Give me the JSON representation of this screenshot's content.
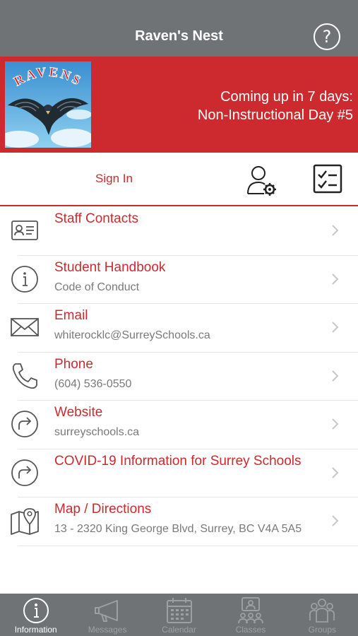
{
  "header": {
    "title": "Raven's Nest",
    "help_symbol": "?"
  },
  "banner": {
    "logo_text": "RAVENS",
    "line1": "Coming up in 7 days:",
    "line2": "Non-Instructional Day #5"
  },
  "signin": {
    "label": "Sign In"
  },
  "list": {
    "items": [
      {
        "title": "Staff Contacts",
        "subtitle": "",
        "icon": "contact-card-icon"
      },
      {
        "title": "Student Handbook",
        "subtitle": "Code of Conduct",
        "icon": "info-icon"
      },
      {
        "title": "Email",
        "subtitle": "whiterocklc@SurreySchools.ca",
        "icon": "envelope-icon"
      },
      {
        "title": "Phone",
        "subtitle": "(604) 536-0550",
        "icon": "phone-icon"
      },
      {
        "title": "Website",
        "subtitle": "surreyschools.ca",
        "icon": "share-arrow-icon"
      },
      {
        "title": "COVID-19 Information for Surrey Schools",
        "subtitle": "",
        "icon": "share-arrow-icon"
      },
      {
        "title": "Map / Directions",
        "subtitle": "13 - 2320 King George Blvd, Surrey, BC V4A 5A5",
        "icon": "map-pin-icon"
      }
    ]
  },
  "tabs": [
    {
      "label": "Information",
      "icon": "info-icon",
      "active": true
    },
    {
      "label": "Messages",
      "icon": "megaphone-icon",
      "active": false
    },
    {
      "label": "Calendar",
      "icon": "calendar-icon",
      "active": false
    },
    {
      "label": "Classes",
      "icon": "classes-icon",
      "active": false
    },
    {
      "label": "Groups",
      "icon": "groups-icon",
      "active": false
    }
  ],
  "colors": {
    "brand_red": "#cc2a2f",
    "header_gray": "#6f7375",
    "text_gray": "#7a7a7a"
  }
}
